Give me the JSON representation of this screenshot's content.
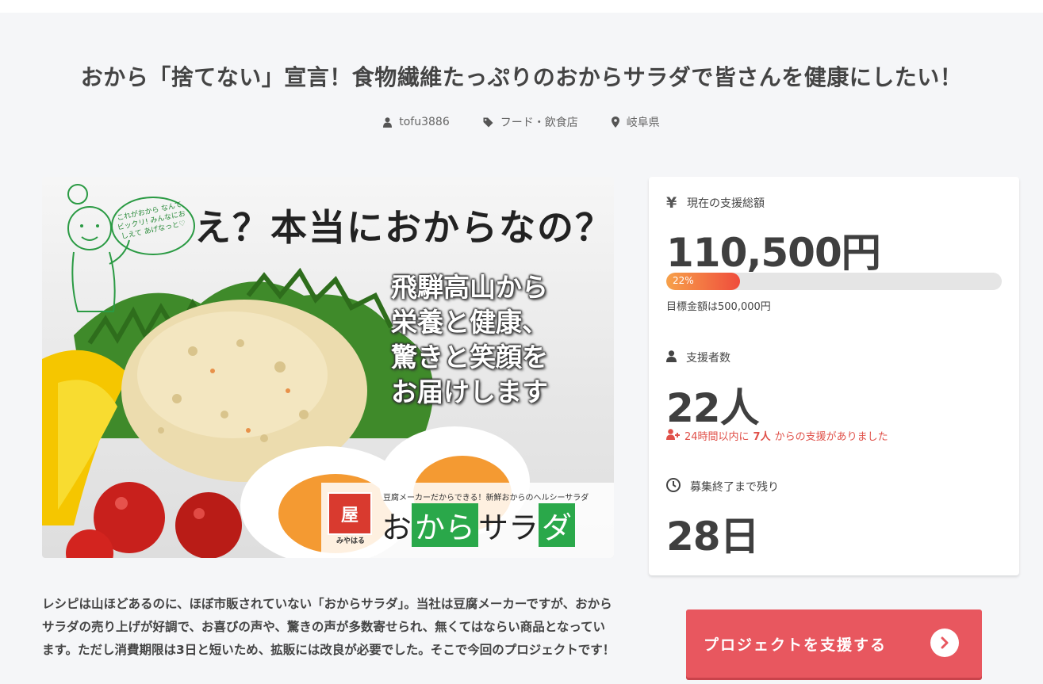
{
  "project": {
    "title": "おから「捨てない」宣言！食物繊維たっぷりのおからサラダで皆さんを健康にしたい！",
    "owner": "tofu3886",
    "category": "フード・飲食店",
    "location": "岐阜県"
  },
  "hero": {
    "headline": "え？本当におからなの？",
    "subtext": "飛騨高山から\n栄養と健康、\n驚きと笑顔を\nお届けします",
    "bubble": "これがおから なんてビックリ! みんなにおしえて あげなっと♡",
    "brand_tagline": "豆腐メーカーだからできる！新鮮おからのヘルシーサラダ",
    "brand_logo_char": "屋",
    "brand_logo_sub": "みやはる",
    "brand_name_parts": [
      "お",
      "から",
      "サラ",
      "ダ"
    ]
  },
  "description": "レシピは山ほどあるのに、ほぼ市販されていない「おからサラダ」。当社は豆腐メーカーですが、おからサラダの売り上げが好調で、お喜びの声や、驚きの声が多数寄せられ、無くてはならい商品となっています。ただし消費期限は3日と短いため、拡販には改良が必要でした。そこで今回のプロジェクトです！",
  "stats": {
    "amount_label": "現在の支援総額",
    "amount_value": "110,500円",
    "progress_percent": 22,
    "progress_text": "22%",
    "goal_text": "目標金額は500,000円",
    "backers_label": "支援者数",
    "backers_value": "22人",
    "recent_prefix": "24時間以内に",
    "recent_count": "7人",
    "recent_suffix": "からの支援がありました",
    "remaining_label": "募集終了まで残り",
    "remaining_value": "28日"
  },
  "cta": {
    "label": "プロジェクトを支援する"
  },
  "colors": {
    "accent": "#e8575f",
    "progress_start": "#f7a14a",
    "progress_end": "#ef4c3c",
    "alert": "#e0514a"
  },
  "icons": {
    "owner": "user-icon",
    "category": "tag-icon",
    "location": "map-pin-icon",
    "amount": "yen-icon",
    "backers": "user-icon",
    "recent": "user-plus-icon",
    "remaining": "clock-icon",
    "cta": "chevron-right-circle-icon"
  }
}
